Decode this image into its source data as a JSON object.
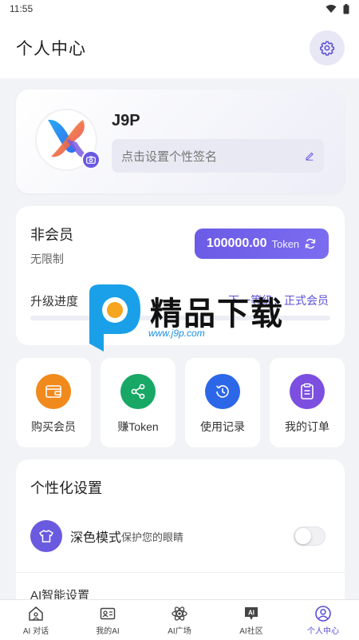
{
  "status_bar": {
    "time": "11:55"
  },
  "header": {
    "title": "个人中心"
  },
  "profile": {
    "username": "J9P",
    "signature_placeholder": "点击设置个性签名"
  },
  "membership": {
    "status": "非会员",
    "limit": "无限制",
    "token_amount": "100000.00",
    "token_unit": "Token",
    "progress_label": "升级进度",
    "next_level_label": "下一等级：正式会员",
    "progress": 0
  },
  "watermark": {
    "text": "精品下载",
    "url": "www.j9p.com"
  },
  "quick_actions": [
    {
      "label": "购买会员",
      "icon": "wallet-icon",
      "color": "#f08a1c"
    },
    {
      "label": "赚Token",
      "icon": "share-icon",
      "color": "#17a865"
    },
    {
      "label": "使用记录",
      "icon": "history-icon",
      "color": "#2c67e8"
    },
    {
      "label": "我的订单",
      "icon": "clipboard-icon",
      "color": "#7c4fe0"
    }
  ],
  "settings": {
    "title": "个性化设置",
    "dark_mode": {
      "name": "深色模式",
      "desc": "保护您的眼睛",
      "enabled": false
    },
    "ai_settings": "AI智能设置"
  },
  "bottom_nav": [
    {
      "label": "AI 对话",
      "icon": "home-chat-icon",
      "active": false
    },
    {
      "label": "我的AI",
      "icon": "id-card-icon",
      "active": false
    },
    {
      "label": "AI广场",
      "icon": "atom-icon",
      "active": false
    },
    {
      "label": "AI社区",
      "icon": "ai-community-icon",
      "active": false
    },
    {
      "label": "个人中心",
      "icon": "user-icon",
      "active": true
    }
  ],
  "colors": {
    "accent": "#6b5be6"
  }
}
